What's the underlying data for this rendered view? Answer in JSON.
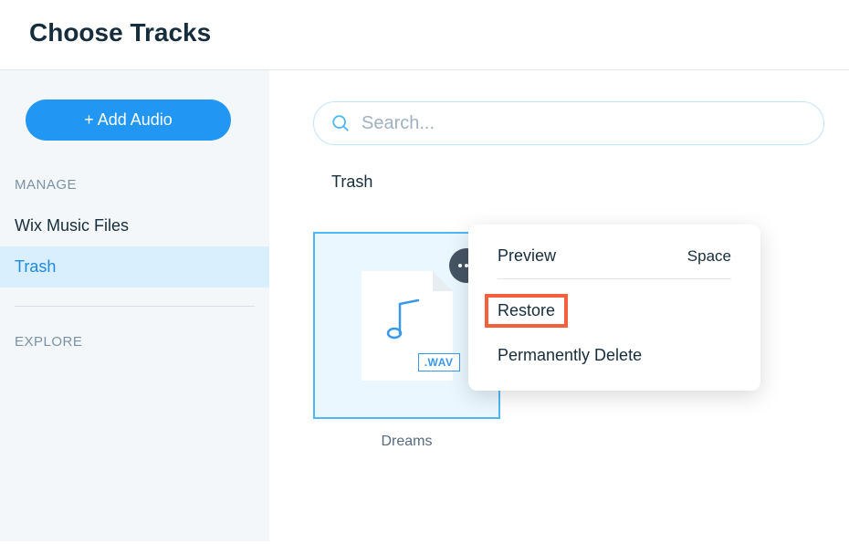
{
  "header": {
    "title": "Choose Tracks"
  },
  "sidebar": {
    "add_audio_label": "+ Add Audio",
    "manage_label": "MANAGE",
    "explore_label": "EXPLORE",
    "items": {
      "wix_music_files": "Wix Music Files",
      "trash": "Trash"
    }
  },
  "search": {
    "placeholder": "Search..."
  },
  "breadcrumb": "Trash",
  "file": {
    "ext_label": ".WAV",
    "name": "Dreams"
  },
  "context_menu": {
    "preview": "Preview",
    "preview_shortcut": "Space",
    "restore": "Restore",
    "permanently_delete": "Permanently Delete"
  }
}
